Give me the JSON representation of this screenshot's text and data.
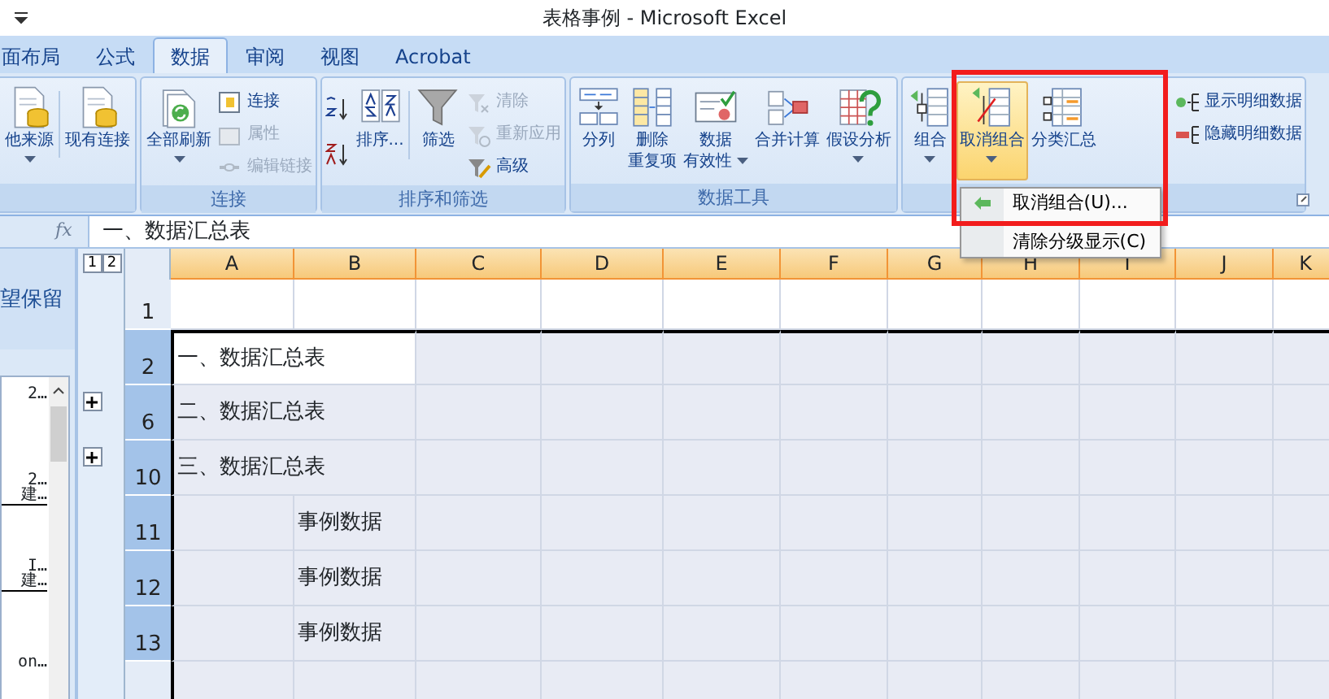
{
  "window": {
    "title": "表格事例 - Microsoft Excel"
  },
  "tabs": [
    {
      "label": "面布局",
      "selected": false
    },
    {
      "label": "公式",
      "selected": false
    },
    {
      "label": "数据",
      "selected": true
    },
    {
      "label": "审阅",
      "selected": false
    },
    {
      "label": "视图",
      "selected": false
    },
    {
      "label": "Acrobat",
      "selected": false
    }
  ],
  "ribbon": {
    "groups": [
      {
        "items": [
          {
            "kind": "large",
            "lines": [
              "他来源"
            ],
            "dropdown": true,
            "disabled": false,
            "expanded": false
          },
          {
            "kind": "separator"
          },
          {
            "kind": "large",
            "lines": [
              "现有连接"
            ],
            "dropdown": false,
            "disabled": false,
            "expanded": false
          }
        ]
      },
      {
        "label": "连接",
        "items": [
          {
            "kind": "large",
            "lines": [
              "全部刷新"
            ],
            "dropdown": true,
            "disabled": false,
            "expanded": false
          },
          {
            "kind": "small",
            "label": "连接",
            "disabled": false
          },
          {
            "kind": "small",
            "label": "属性",
            "disabled": true
          },
          {
            "kind": "small",
            "label": "编辑链接",
            "disabled": true
          }
        ]
      },
      {
        "label": "排序和筛选",
        "items": [
          {
            "kind": "icon"
          },
          {
            "kind": "icon"
          },
          {
            "kind": "large",
            "lines": [
              "排序..."
            ],
            "dropdown": false,
            "disabled": false,
            "expanded": false
          },
          {
            "kind": "separator"
          },
          {
            "kind": "large",
            "lines": [
              "筛选"
            ],
            "dropdown": false,
            "disabled": false,
            "expanded": false
          },
          {
            "kind": "small",
            "label": "清除",
            "disabled": true
          },
          {
            "kind": "small",
            "label": "重新应用",
            "disabled": true
          },
          {
            "kind": "small",
            "label": "高级",
            "disabled": false
          }
        ]
      },
      {
        "label": "数据工具",
        "items": [
          {
            "kind": "large",
            "lines": [
              "分列"
            ],
            "dropdown": false,
            "disabled": false,
            "expanded": false
          },
          {
            "kind": "large",
            "lines": [
              "删除",
              "重复项"
            ],
            "dropdown": false,
            "disabled": false,
            "expanded": false
          },
          {
            "kind": "large",
            "lines": [
              "数据",
              "有效性"
            ],
            "dropdown": true,
            "disabled": false,
            "expanded": false
          },
          {
            "kind": "large",
            "lines": [
              "合并计算"
            ],
            "dropdown": false,
            "disabled": false,
            "expanded": false
          },
          {
            "kind": "large",
            "lines": [
              "假设分析"
            ],
            "dropdown": true,
            "disabled": false,
            "expanded": false
          }
        ]
      },
      {
        "items": [
          {
            "kind": "large",
            "lines": [
              "组合"
            ],
            "dropdown": true,
            "disabled": false,
            "expanded": false
          },
          {
            "kind": "large",
            "lines": [
              "取消组合"
            ],
            "dropdown": true,
            "disabled": false,
            "expanded": true
          },
          {
            "kind": "large",
            "lines": [
              "分类汇总"
            ],
            "dropdown": false,
            "disabled": false,
            "expanded": false
          },
          {
            "kind": "small",
            "label": "显示明细数据",
            "disabled": false
          },
          {
            "kind": "small",
            "label": "隐藏明细数据",
            "disabled": false
          }
        ]
      }
    ]
  },
  "dropdown_menu": {
    "items": [
      {
        "label": "取消组合(U)..."
      },
      {
        "label": "清除分级显示(C)"
      }
    ]
  },
  "formula_bar": {
    "fx": "fx",
    "value": "一、数据汇总表"
  },
  "side_panel": {
    "heading": "望保留",
    "list": [
      {
        "text": "2…",
        "rule_after": false
      },
      {
        "text": "2…",
        "rule_after": false
      },
      {
        "text": "建…",
        "rule_after": true
      },
      {
        "text": "I…",
        "rule_after": false
      },
      {
        "text": "建…",
        "rule_after": true
      },
      {
        "text": "on…",
        "rule_after": false
      }
    ]
  },
  "outline_levels": [
    "1",
    "2"
  ],
  "columns": [
    {
      "label": "A",
      "selected": true
    },
    {
      "label": "B",
      "selected": true
    },
    {
      "label": "C",
      "selected": true
    },
    {
      "label": "D",
      "selected": true
    },
    {
      "label": "E",
      "selected": true
    },
    {
      "label": "F",
      "selected": true
    },
    {
      "label": "G",
      "selected": true
    },
    {
      "label": "H",
      "selected": true
    },
    {
      "label": "I",
      "selected": true
    },
    {
      "label": "J",
      "selected": true
    },
    {
      "label": "K",
      "selected": true
    }
  ],
  "rows": [
    {
      "header": "1",
      "selected": false,
      "collapsed": false,
      "active": false
    },
    {
      "header": "2",
      "selected": true,
      "collapsed": false,
      "active": true,
      "title": "一、数据汇总表"
    },
    {
      "header": "6",
      "selected": true,
      "collapsed": true,
      "active": false,
      "title": "二、数据汇总表"
    },
    {
      "header": "10",
      "selected": true,
      "collapsed": true,
      "active": false,
      "title": "三、数据汇总表"
    },
    {
      "header": "11",
      "selected": true,
      "collapsed": false,
      "active": false,
      "value": "事例数据"
    },
    {
      "header": "12",
      "selected": true,
      "collapsed": false,
      "active": false,
      "value": "事例数据"
    },
    {
      "header": "13",
      "selected": true,
      "collapsed": false,
      "active": false,
      "value": "事例数据"
    }
  ]
}
